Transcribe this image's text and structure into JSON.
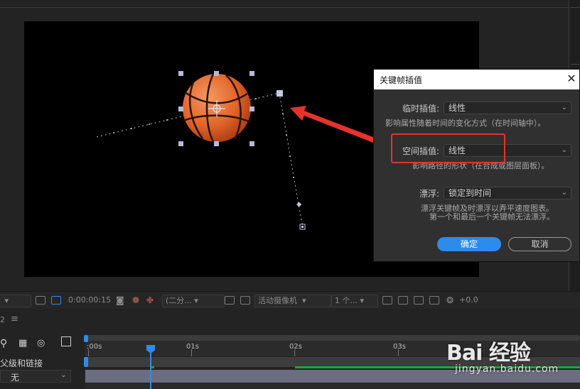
{
  "dialog": {
    "title": "关键帧插值",
    "temporal": {
      "label": "临时插值:",
      "value": "线性",
      "description": "影响属性随着时间的变化方式（在时间轴中）。"
    },
    "spatial": {
      "label": "空间插值:",
      "value": "线性",
      "description": "影响路径的形状（在合成或图层面板）。"
    },
    "roving": {
      "label": "漂浮:",
      "value": "锁定到时间",
      "description_line1": "漂浮关键帧及时漂浮以弄平速度图表。",
      "description_line2": "第一个和最后一个关键帧无法漂浮。"
    },
    "ok_label": "确定",
    "cancel_label": "取消",
    "close_symbol": "✕"
  },
  "comp_toolbar": {
    "timecode": "0:00:00:15",
    "resolution": "(二分...",
    "camera": "活动摄像机",
    "views": "1 个...",
    "exposure": "+0.0"
  },
  "timeline": {
    "panel_number": "2",
    "menu_symbol": "≡",
    "parent_link_label": "父级和链接",
    "parent_value": "无",
    "ticks": [
      ":00s",
      "01s",
      "02s",
      "03s"
    ]
  },
  "watermark": {
    "logo_text": "Bai 经验",
    "sub_text": "jingyan.baidu.com"
  },
  "colors": {
    "accent": "#2d8ceb",
    "highlight": "#e3332b",
    "ball": "#e2652a",
    "track_green": "#1fa63a"
  }
}
